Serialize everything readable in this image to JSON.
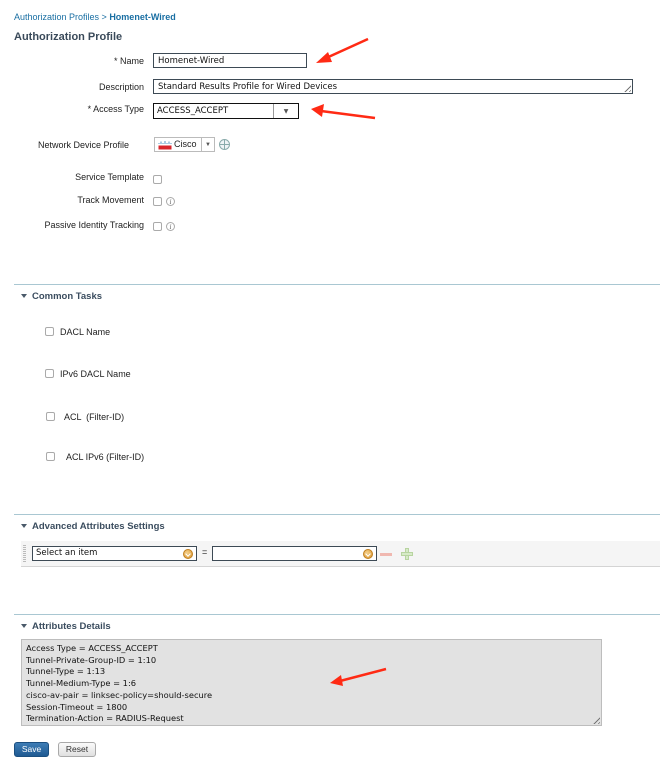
{
  "breadcrumb": {
    "parent": "Authorization Profiles",
    "separator": " > ",
    "current": "Homenet-Wired"
  },
  "page_title": "Authorization Profile",
  "form": {
    "name": {
      "label": "* Name",
      "value": "Homenet-Wired"
    },
    "description": {
      "label": "Description",
      "value": "Standard Results Profile for Wired Devices"
    },
    "access_type": {
      "label": "* Access Type",
      "value": "ACCESS_ACCEPT"
    },
    "network_device_profile": {
      "label": "Network Device Profile",
      "value": "Cisco"
    },
    "service_template": {
      "label": "Service Template",
      "checked": false
    },
    "track_movement": {
      "label": "Track Movement",
      "checked": false
    },
    "passive_identity_tracking": {
      "label": "Passive Identity Tracking",
      "checked": false
    }
  },
  "common_tasks": {
    "title": "Common Tasks",
    "items": [
      {
        "label": "DACL Name",
        "checked": false
      },
      {
        "label": "IPv6 DACL Name",
        "checked": false
      },
      {
        "label": "ACL  (Filter-ID)",
        "checked": false
      },
      {
        "label": "ACL IPv6 (Filter-ID)",
        "checked": false
      }
    ]
  },
  "advanced_attributes": {
    "title": "Advanced Attributes Settings",
    "row": {
      "attribute_placeholder": "Select an item",
      "operator": "=",
      "value": ""
    }
  },
  "attributes_details": {
    "title": "Attributes Details",
    "lines": [
      "Access Type = ACCESS_ACCEPT",
      "Tunnel-Private-Group-ID = 1:10",
      "Tunnel-Type = 1:13",
      "Tunnel-Medium-Type = 1:6",
      "cisco-av-pair = linksec-policy=should-secure",
      "Session-Timeout = 1800",
      "Termination-Action = RADIUS-Request"
    ]
  },
  "buttons": {
    "save": "Save",
    "reset": "Reset"
  },
  "colors": {
    "link": "#1a6fa3",
    "annotation_arrow": "#ff2a14",
    "save_button": "#2a67a0"
  }
}
